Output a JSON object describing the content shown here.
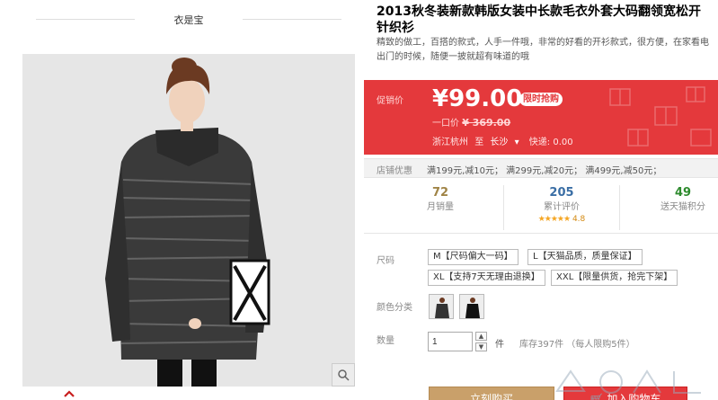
{
  "shop": {
    "name": "衣是宝"
  },
  "product": {
    "title_line1": "2013秋冬装新款韩版女装中长款毛衣外套大码翻领宽松开",
    "title_line2": "针织衫",
    "subtitle_line1": "精致的做工，百搭的款式，人手一件哦，非常的好看的开衫款式，很方便，在家看电",
    "subtitle_line2": "出门的时候，随便一披就超有味道的哦"
  },
  "price": {
    "label": "促销价",
    "value": "¥99.00",
    "badge": "限时抢购",
    "original_label": "一口价",
    "original_value": "¥ 369.00",
    "ship_from": "浙江杭州",
    "ship_to_word": "至",
    "ship_city": "长沙",
    "ship_fee": "快递: 0.00",
    "colors": {
      "panel": "#e4393c"
    }
  },
  "coupon": {
    "label": "店铺优惠",
    "text": "满199元,减10元；  满299元,减20元；  满499元,减50元；"
  },
  "stats": {
    "monthly_sales": {
      "value": "72",
      "label": "月销量"
    },
    "reviews": {
      "value": "205",
      "label": "累计评价",
      "stars": "★★★★★",
      "score": "4.8"
    },
    "points": {
      "value": "49",
      "label": "送天猫积分"
    }
  },
  "size": {
    "label": "尺码",
    "options": [
      "M【尺码偏大一码】",
      "L【天猫品质，质量保证】",
      "XL【支持7天无理由退换】",
      "XXL【限量供货，抢完下架】"
    ]
  },
  "color": {
    "label": "颜色分类"
  },
  "quantity": {
    "label": "数量",
    "value": "1",
    "unit": "件",
    "stock": "库存397件  （每人限购5件）"
  },
  "actions": {
    "buy_now": "立刻购买",
    "add_cart": "加入购物车"
  },
  "icons": [
    "zoom-icon",
    "chevron-up-icon",
    "cart-icon",
    "chevron-down-icon"
  ]
}
